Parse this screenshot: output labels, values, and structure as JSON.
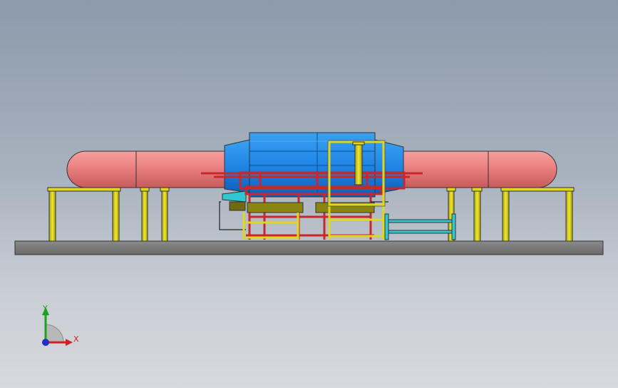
{
  "viewport": {
    "background_top": "#8c9aac",
    "background_bottom": "#d6d9dd"
  },
  "model": {
    "colors": {
      "pipe": "#e87878",
      "pipe_dark": "#c85a5a",
      "body_blue": "#1f88e8",
      "body_blue_dark": "#0f5fb8",
      "frame_red": "#c8282a",
      "support_yellow": "#e0d820",
      "support_yellow_dark": "#8a8410",
      "rail_cyan": "#30c8d0",
      "base_gray": "#7a7a7a"
    }
  },
  "triad": {
    "x_label": "X",
    "y_label": "Y",
    "x_color": "#d02020",
    "y_color": "#20a020",
    "z_color": "#2030c0"
  }
}
